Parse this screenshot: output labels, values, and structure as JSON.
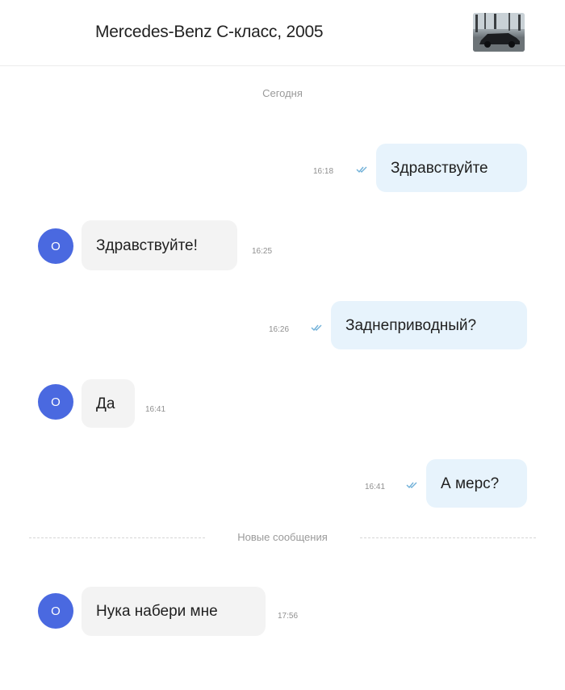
{
  "header": {
    "title": "Mercedes-Benz C-класс, 2005",
    "thumbnail_icon": "car-photo"
  },
  "day_label": "Сегодня",
  "new_messages_label": "Новые сообщения",
  "messages": [
    {
      "direction": "outgoing",
      "text": "Здравствуйте",
      "time": "16:18",
      "status": "read"
    },
    {
      "direction": "incoming",
      "text": "Здравствуйте!",
      "time": "16:25",
      "avatar": "О"
    },
    {
      "direction": "outgoing",
      "text": "Заднеприводный?",
      "time": "16:26",
      "status": "read"
    },
    {
      "direction": "incoming",
      "text": "Да",
      "time": "16:41",
      "avatar": "О"
    },
    {
      "direction": "outgoing",
      "text": "А мерс?",
      "time": "16:41",
      "status": "read"
    },
    {
      "direction": "incoming",
      "text": "Нука набери мне",
      "time": "17:56",
      "avatar": "О"
    }
  ],
  "colors": {
    "outgoing_bubble": "#e7f3fc",
    "incoming_bubble": "#f3f3f3",
    "avatar": "#4a69e0",
    "read_ticks": "#6fb0d8"
  }
}
